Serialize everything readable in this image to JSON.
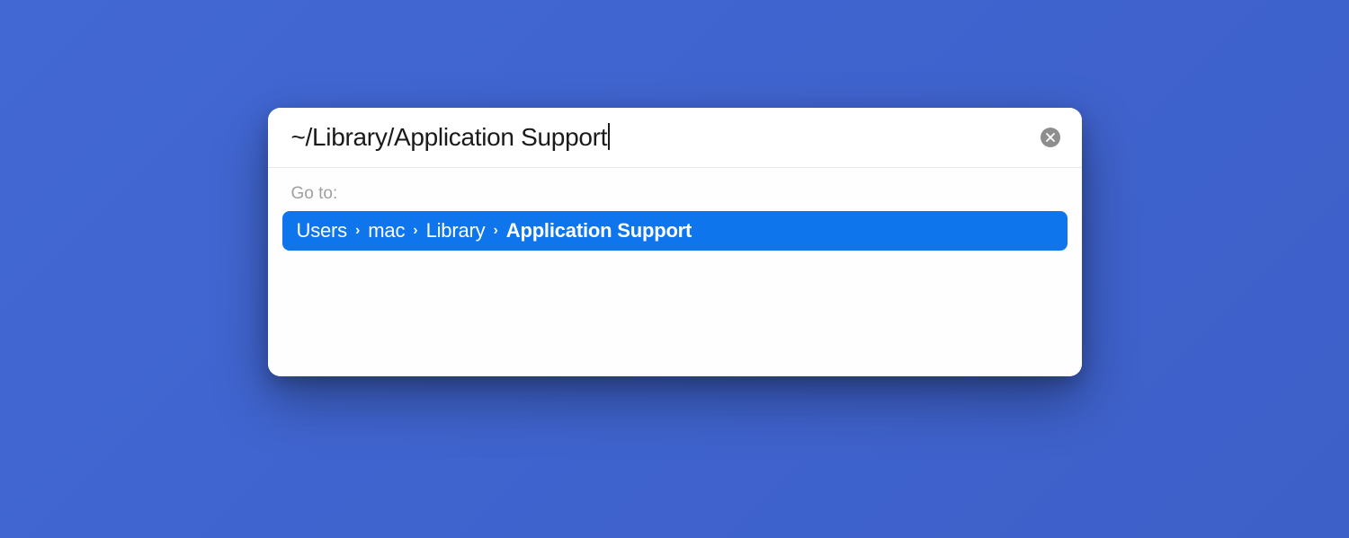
{
  "input": {
    "value": "~/Library/Application Support"
  },
  "goto_label": "Go to:",
  "result": {
    "crumbs": [
      {
        "text": "Users",
        "bold": false
      },
      {
        "text": "mac",
        "bold": false
      },
      {
        "text": "Library",
        "bold": false
      },
      {
        "text": "Application Support",
        "bold": true
      }
    ]
  },
  "chevron": "›"
}
